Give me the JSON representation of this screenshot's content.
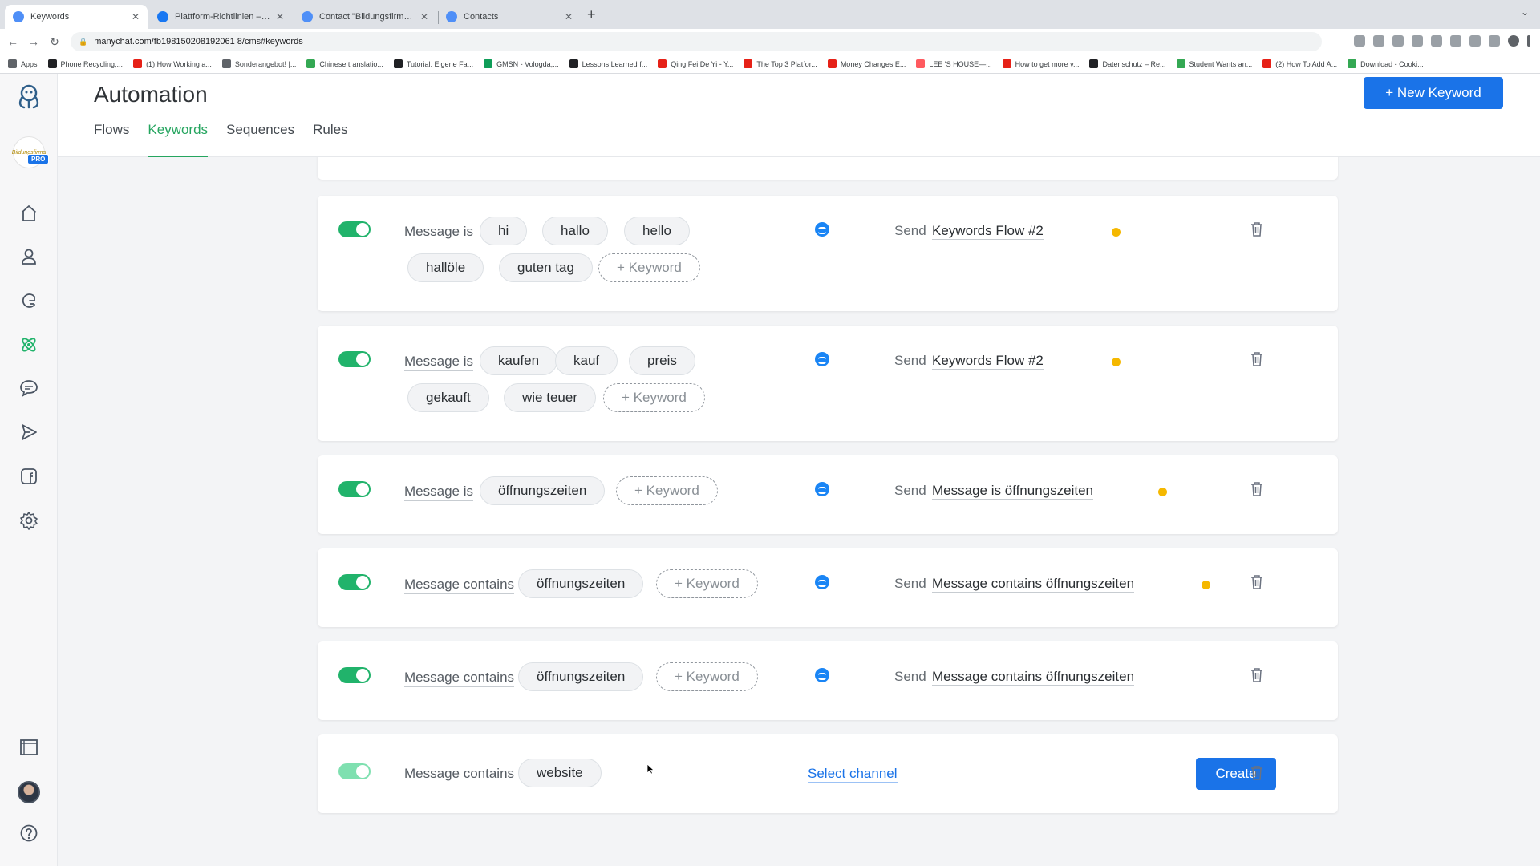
{
  "browser": {
    "tabs": [
      {
        "title": "Keywords",
        "active": true
      },
      {
        "title": "Plattform-Richtlinien – Übersic",
        "active": false
      },
      {
        "title": "Contact \"Bildungsfirma\" throu",
        "active": false
      },
      {
        "title": "Contacts",
        "active": false
      }
    ],
    "url": "manychat.com/fb198150208192061 8/cms#keywords",
    "bookmarks": [
      "Apps",
      "Phone Recycling,...",
      "(1) How Working a...",
      "Sonderangebot! |...",
      "Chinese translatio...",
      "Tutorial: Eigene Fa...",
      "GMSN - Vologda,...",
      "Lessons Learned f...",
      "Qing Fei De Yi - Y...",
      "The Top 3 Platfor...",
      "Money Changes E...",
      "LEE 'S HOUSE—...",
      "How to get more v...",
      "Datenschutz – Re...",
      "Student Wants an...",
      "(2) How To Add A...",
      "Download - Cooki..."
    ]
  },
  "sidebar": {
    "page_avatar_text": "Bildungsfirma",
    "pro_badge": "PRO",
    "items": [
      "home-icon",
      "contacts-icon",
      "growth-tools-icon",
      "automation-icon",
      "live-chat-icon",
      "broadcasting-icon",
      "facebook-ads-icon",
      "settings-icon",
      "templates-icon",
      "help-icon"
    ]
  },
  "header": {
    "title": "Automation",
    "new_keyword_label": "+ New Keyword",
    "tabs": [
      {
        "label": "Flows",
        "active": false
      },
      {
        "label": "Keywords",
        "active": true
      },
      {
        "label": "Sequences",
        "active": false
      },
      {
        "label": "Rules",
        "active": false
      }
    ]
  },
  "rules": [
    {
      "condition": "Message is",
      "keywords_row1": [
        "hi",
        "hallo",
        "hello"
      ],
      "keywords_row2": [
        "hallöle",
        "guten tag"
      ],
      "add_keyword": "+ Keyword",
      "send_label": "Send",
      "flow": "Keywords Flow #2",
      "has_draft_dot": true
    },
    {
      "condition": "Message is",
      "keywords_row1": [
        "kaufen",
        "kauf",
        "preis"
      ],
      "keywords_row2": [
        "gekauft",
        "wie teuer"
      ],
      "add_keyword": "+ Keyword",
      "send_label": "Send",
      "flow": "Keywords Flow #2",
      "has_draft_dot": true
    },
    {
      "condition": "Message is",
      "keywords_row1": [
        "öffnungszeiten"
      ],
      "add_keyword": "+ Keyword",
      "send_label": "Send",
      "flow": "Message is öffnungszeiten",
      "has_draft_dot": true
    },
    {
      "condition": "Message contains",
      "keywords_row1": [
        "öffnungszeiten"
      ],
      "add_keyword": "+ Keyword",
      "send_label": "Send",
      "flow": "Message contains öffnungszeiten",
      "has_draft_dot": true
    },
    {
      "condition": "Message contains",
      "keywords_row1": [
        "öffnungszeiten"
      ],
      "add_keyword": "+ Keyword",
      "send_label": "Send",
      "flow": "Message contains öffnungszeiten",
      "has_draft_dot": false
    }
  ],
  "new_rule": {
    "condition": "Message contains",
    "keyword": "website",
    "select_channel_label": "Select channel",
    "create_label": "Create"
  },
  "colors": {
    "accent_green": "#21b36b",
    "primary_blue": "#1a73e8",
    "draft_yellow": "#f5b800",
    "messenger_blue": "#1a85f5"
  }
}
